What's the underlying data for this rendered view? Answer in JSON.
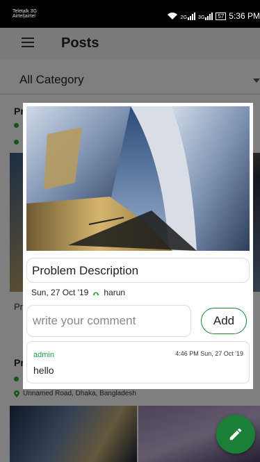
{
  "status_bar": {
    "carrier_line1": "Teletalk 3G",
    "carrier_line2": "Airtel|airtel",
    "network1": "2G",
    "network2": "3G",
    "battery": "57",
    "time": "5:36 PM"
  },
  "app_bar": {
    "title": "Posts",
    "menu_icon": "hamburger-menu-icon"
  },
  "category_filter": {
    "selected": "All Category"
  },
  "background_list": {
    "item1_title_partial": "Pr",
    "item_partial_text": "Pr",
    "item2_title_partial": "Pr",
    "item2_location": "Unnamed Road, Dhaka, Bangladesh"
  },
  "dialog": {
    "problem_title": "Problem Description",
    "date": "Sun, 27 Oct '19",
    "author": "harun",
    "comment_placeholder": "write your comment",
    "add_label": "Add",
    "comments": [
      {
        "author": "admin",
        "time": "4:46 PM  Sun, 27 Oct '19",
        "text": "hello"
      }
    ]
  },
  "fab": {
    "icon": "pencil-icon"
  },
  "colors": {
    "accent_green": "#1b7f37",
    "author_green": "#1f9e4a"
  }
}
